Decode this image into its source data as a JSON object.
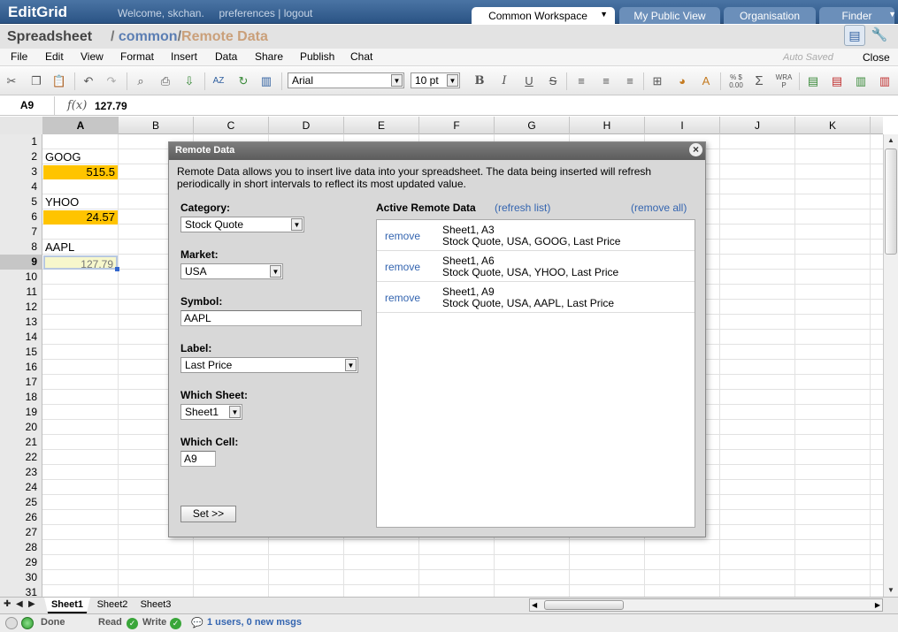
{
  "app": {
    "logo": "EditGrid",
    "welcome": "Welcome, skchan.",
    "preferences": "preferences",
    "separator": "|",
    "logout": "logout"
  },
  "workspace_tabs": [
    "Common Workspace",
    "My Public View",
    "Organisation",
    "Finder"
  ],
  "title": {
    "doc_type": "Spreadsheet",
    "slash1": "/",
    "folder": "common",
    "slash2": "/",
    "name": "Remote Data"
  },
  "menu": [
    "File",
    "Edit",
    "View",
    "Format",
    "Insert",
    "Data",
    "Share",
    "Publish",
    "Chat"
  ],
  "autosaved": "Auto Saved",
  "close": "Close",
  "toolbar": {
    "font": "Arial",
    "size": "10 pt",
    "bold": "B",
    "italic": "I",
    "underline": "U",
    "strike": "S",
    "percent": "% $ 0.00",
    "sum": "Σ",
    "wrap": "WRA P"
  },
  "formula": {
    "cell_ref": "A9",
    "fx": "f(x)",
    "value": "127.79"
  },
  "columns": [
    "A",
    "B",
    "C",
    "D",
    "E",
    "F",
    "G",
    "H",
    "I",
    "J",
    "K"
  ],
  "rows": [
    "1",
    "2",
    "3",
    "4",
    "5",
    "6",
    "7",
    "8",
    "9",
    "10",
    "11",
    "12",
    "13",
    "14",
    "15",
    "16",
    "17",
    "18",
    "19",
    "20",
    "21",
    "22",
    "23",
    "24",
    "25",
    "26",
    "27",
    "28",
    "29",
    "30",
    "31"
  ],
  "cells": {
    "a2": "GOOG",
    "a3": "515.5",
    "a5": "YHOO",
    "a6": "24.57",
    "a8": "AAPL",
    "a9": "127.79"
  },
  "sheets": [
    "Sheet1",
    "Sheet2",
    "Sheet3"
  ],
  "status": {
    "done": "Done",
    "read": "Read",
    "write": "Write",
    "users": "1 users, 0 new msgs"
  },
  "dialog": {
    "title": "Remote Data",
    "intro": "Remote Data allows you to insert live data into your spreadsheet. The data being inserted will refresh periodically in short intervals to reflect its most updated value.",
    "category_label": "Category:",
    "category": "Stock Quote",
    "market_label": "Market:",
    "market": "USA",
    "symbol_label": "Symbol:",
    "symbol": "AAPL",
    "label_label": "Label:",
    "label": "Last Price",
    "sheet_label": "Which Sheet:",
    "sheet": "Sheet1",
    "cell_label": "Which Cell:",
    "cell": "A9",
    "set_button": "Set >>",
    "active_title": "Active Remote Data",
    "refresh": "(refresh list)",
    "remove_all": "(remove all)",
    "active": [
      {
        "remove": "remove",
        "loc": "Sheet1, A3",
        "desc": "Stock Quote, USA, GOOG, Last Price"
      },
      {
        "remove": "remove",
        "loc": "Sheet1, A6",
        "desc": "Stock Quote, USA, YHOO, Last Price"
      },
      {
        "remove": "remove",
        "loc": "Sheet1, A9",
        "desc": "Stock Quote, USA, AAPL, Last Price"
      }
    ]
  },
  "colors": {
    "highlight": "#ffc400",
    "selected_fill": "#f7f7cc",
    "link": "#3465b0",
    "topbar": "#2f5a8e"
  }
}
